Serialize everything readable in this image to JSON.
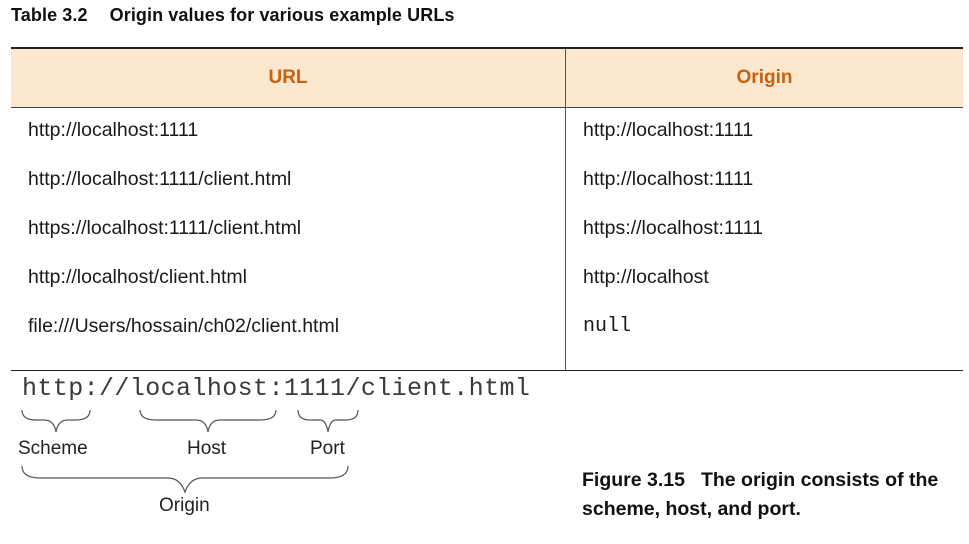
{
  "table": {
    "number": "Table 3.2",
    "title": "Origin values for various example URLs",
    "headers": [
      "URL",
      "Origin"
    ],
    "rows": [
      {
        "url": "http://localhost:1111",
        "origin": "http://localhost:1111"
      },
      {
        "url": "http://localhost:1111/client.html",
        "origin": "http://localhost:1111"
      },
      {
        "url": "https://localhost:1111/client.html",
        "origin": "https://localhost:1111"
      },
      {
        "url": "http://localhost/client.html",
        "origin": "http://localhost"
      },
      {
        "url": "file:///Users/hossain/ch02/client.html",
        "origin": "null"
      }
    ]
  },
  "figure": {
    "url_text": "http://localhost:1111/client.html",
    "labels": {
      "scheme": "Scheme",
      "host": "Host",
      "port": "Port",
      "origin": "Origin"
    },
    "number": "Figure 3.15",
    "caption": "The origin consists of the scheme, host, and port."
  }
}
